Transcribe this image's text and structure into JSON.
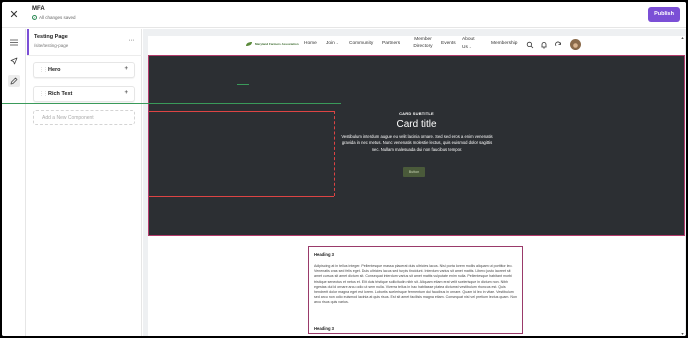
{
  "topbar": {
    "site_title": "MFA",
    "save_status": "All changes saved",
    "publish_label": "Publish"
  },
  "panel": {
    "page_name": "Testing Page",
    "page_path": "/site/testing-page",
    "components": [
      {
        "label": "Hero"
      },
      {
        "label": "Rich Text"
      }
    ],
    "add_label": "Add a New Component"
  },
  "site": {
    "logo_text": "Maryland Farmers Association",
    "nav": [
      {
        "label": "Home"
      },
      {
        "label": "Join",
        "dropdown": true
      },
      {
        "label": "Community"
      },
      {
        "label": "Partners"
      },
      {
        "label": "Member Directory"
      },
      {
        "label": "Events"
      },
      {
        "label": "About Us",
        "dropdown": true
      },
      {
        "label": "Membership"
      }
    ]
  },
  "hero": {
    "subtitle": "CARD SUBTITLE",
    "title": "Card title",
    "text": "Vestibulum interdum augue eu velit lacinia ornare. Sed sed eros a enim venenatis gravida in nec metus. Nunc venenatis molestie lectus, quis euismod dolor sagittis nec. Nullam malesuada dui non faucibus tempor.",
    "button": "Button",
    "bg_color": "#2c2f33",
    "outline_color": "#b33a6b"
  },
  "rich_text": {
    "heading1": "Heading 3",
    "paragraph": "Adipiscing at in tellus integer. Pellentesque massa placerat duis ultricies lacus. Nisi porta lorem mollis aliquam ut porttitor leo. Venenatis cras sed felis eget. Duis ultricies lacus sed turpis tincidunt. Interdum varius sit amet mattis. Libero justo laoreet sit amet cursus sit amet dictum sit. Consequat interdum varius sit amet mattis vulputate enim nulla. Pellentesque habitant morbi tristique senectus et netus et. Elit duis tristique sollicitudin nibh sit. Aliquam etiam erat velit scelerisque in dictum non. Nibh egestas dui id ornare arcu odio ut sem nulla. Viverra tellus in hac habitasse platea dictumst vestibulum rhoncus est. Quis hendrerit dolor magna eget est lorem. Lobortis scelerisque fermentum dui faucibus in ornare. Quam id leo in vitae. Vestibulum sed arcu non odio euismod lacinia at quis risus. Est sit amet facilisis magna etiam. Consequat nisl vel pretium lectus quam. Non arcu risus quis varius.",
    "heading2": "Heading 3"
  },
  "colors": {
    "accent": "#7b4fd6",
    "selection": "#b33a6b"
  }
}
